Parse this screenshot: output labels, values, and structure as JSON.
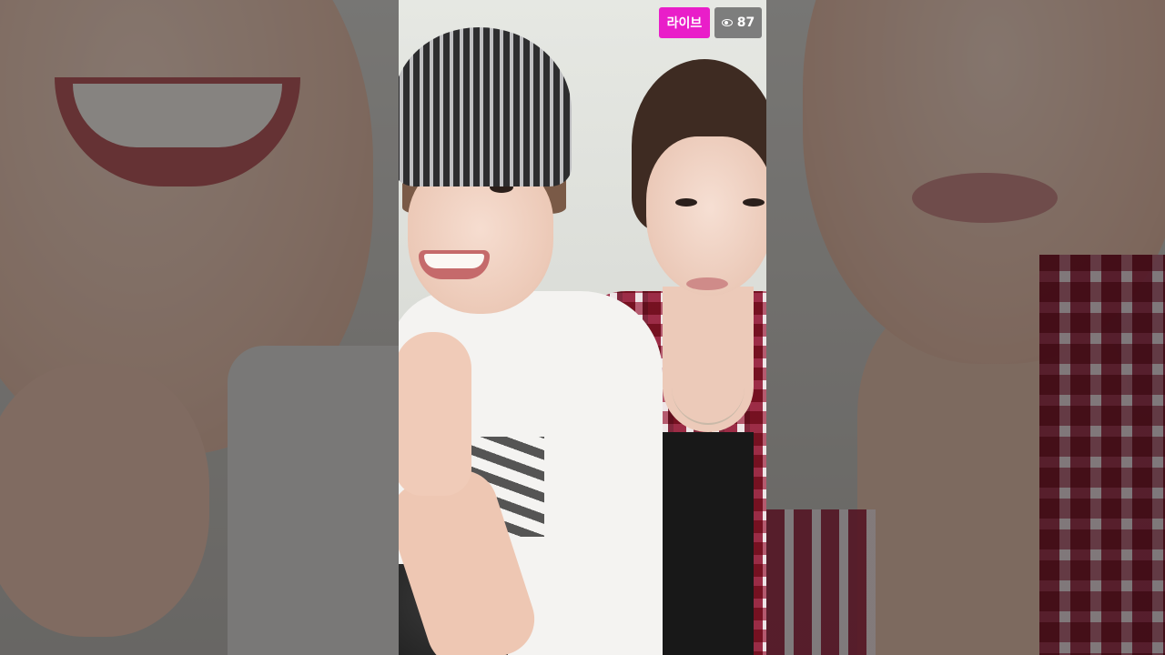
{
  "stream": {
    "live_label": "라이브",
    "viewer_count": "87",
    "viewer_icon": "eye-icon",
    "colors": {
      "live_badge": "#e91ec9",
      "viewer_badge": "#6e6e6e"
    }
  }
}
